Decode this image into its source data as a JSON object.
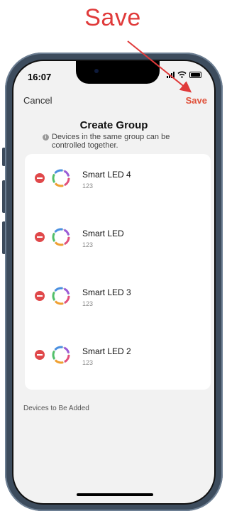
{
  "annotation": {
    "label": "Save",
    "color": "#e03a3a"
  },
  "status_bar": {
    "time": "16:07"
  },
  "nav": {
    "cancel_label": "Cancel",
    "save_label": "Save",
    "save_color": "#e0513a"
  },
  "page": {
    "title": "Create Group",
    "subtitle": "Devices in the same group can be controlled together."
  },
  "devices": [
    {
      "name": "Smart LED 4",
      "id": "123"
    },
    {
      "name": "Smart LED",
      "id": "123"
    },
    {
      "name": "Smart LED 3",
      "id": "123"
    },
    {
      "name": "Smart LED 2",
      "id": "123"
    }
  ],
  "section": {
    "devices_to_add_label": "Devices to Be Added"
  }
}
